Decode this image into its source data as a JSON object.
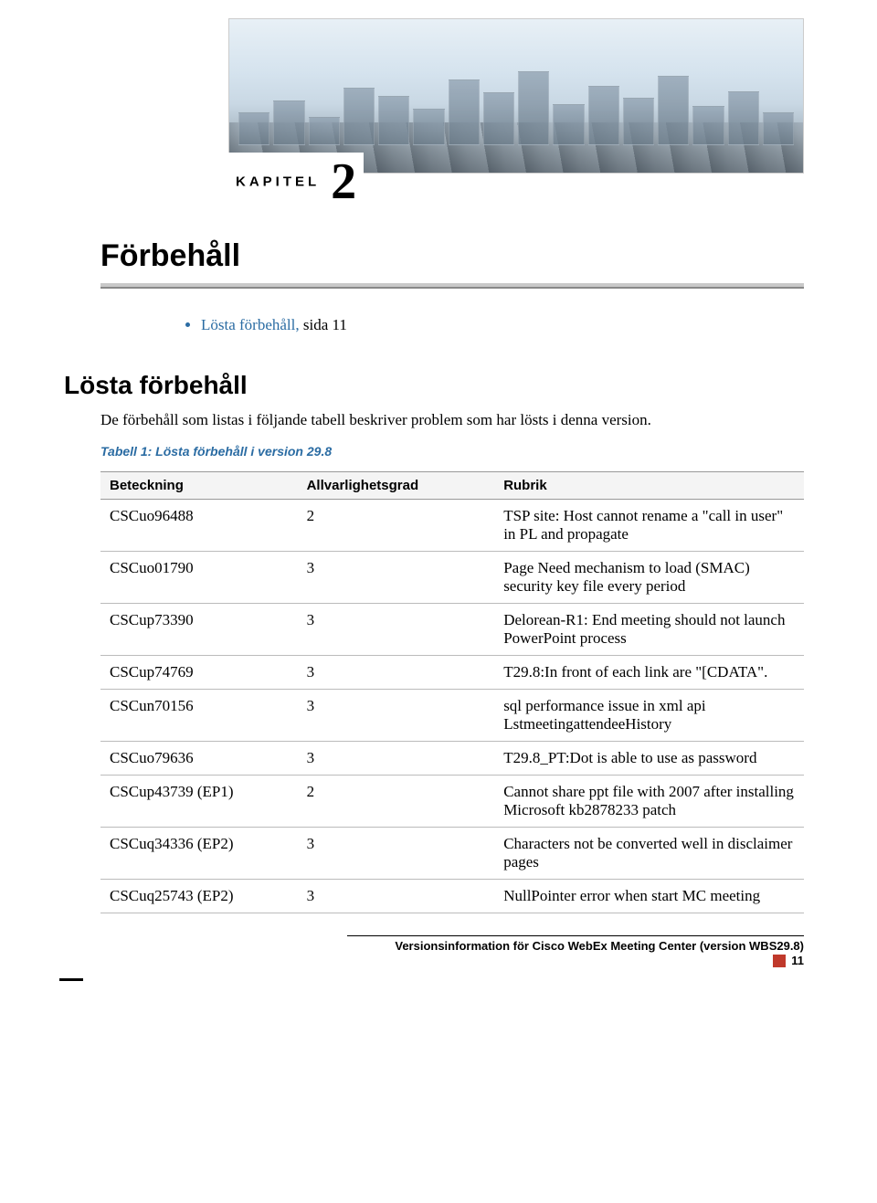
{
  "chapter": {
    "label": "KAPITEL",
    "number": "2",
    "title": "Förbehåll"
  },
  "toc": {
    "items": [
      {
        "link": "Lösta förbehåll,",
        "suffix": " sida 11"
      }
    ]
  },
  "section": {
    "heading": "Lösta förbehåll",
    "intro": "De förbehåll som listas i följande tabell beskriver problem som har lösts i denna version.",
    "table_caption": "Tabell 1: Lösta förbehåll i version 29.8"
  },
  "table": {
    "headers": [
      "Beteckning",
      "Allvarlighetsgrad",
      "Rubrik"
    ],
    "rows": [
      {
        "id": "CSCuo96488",
        "sev": "2",
        "title": "TSP site: Host cannot rename a \"call in user\" in PL and propagate"
      },
      {
        "id": "CSCuo01790",
        "sev": "3",
        "title": "Page Need mechanism to load (SMAC) security key file every period"
      },
      {
        "id": "CSCup73390",
        "sev": "3",
        "title": "Delorean-R1: End meeting should not launch PowerPoint process"
      },
      {
        "id": "CSCup74769",
        "sev": "3",
        "title": "T29.8:In front of each link are \"[CDATA\"."
      },
      {
        "id": "CSCun70156",
        "sev": "3",
        "title": "sql performance issue in xml api LstmeetingattendeeHistory"
      },
      {
        "id": "CSCuo79636",
        "sev": "3",
        "title": "T29.8_PT:Dot is able to use as password"
      },
      {
        "id": "CSCup43739 (EP1)",
        "sev": "2",
        "title": "Cannot share ppt file with 2007 after installing Microsoft kb2878233 patch"
      },
      {
        "id": "CSCuq34336 (EP2)",
        "sev": "3",
        "title": "Characters not be converted well in disclaimer pages"
      },
      {
        "id": "CSCuq25743 (EP2)",
        "sev": "3",
        "title": "NullPointer error when start MC meeting"
      }
    ]
  },
  "footer": {
    "text": "Versionsinformation för Cisco WebEx Meeting Center (version WBS29.8)",
    "page": "11"
  }
}
